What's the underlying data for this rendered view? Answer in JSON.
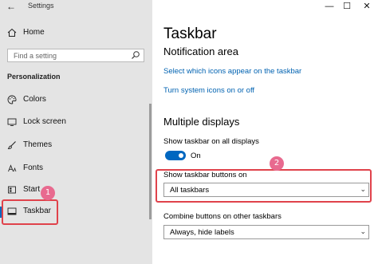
{
  "window": {
    "title": "Settings",
    "back_glyph": "←",
    "minimize_glyph": "—",
    "maximize_glyph": "☐",
    "close_glyph": "✕"
  },
  "sidebar": {
    "home_label": "Home",
    "search_placeholder": "Find a setting",
    "section_title": "Personalization",
    "items": [
      {
        "label": "Colors",
        "icon": "palette-icon"
      },
      {
        "label": "Lock screen",
        "icon": "lock-screen-icon"
      },
      {
        "label": "Themes",
        "icon": "brush-icon"
      },
      {
        "label": "Fonts",
        "icon": "font-icon"
      },
      {
        "label": "Start",
        "icon": "start-icon"
      },
      {
        "label": "Taskbar",
        "icon": "taskbar-icon"
      }
    ],
    "selected": "Taskbar"
  },
  "main": {
    "title": "Taskbar",
    "notification_heading": "Notification area",
    "link_select_icons": "Select which icons appear on the taskbar",
    "link_system_icons": "Turn system icons on or off",
    "multiple_heading": "Multiple displays",
    "show_all_label": "Show taskbar on all displays",
    "toggle_state": "On",
    "show_buttons_label": "Show taskbar buttons on",
    "show_buttons_value": "All taskbars",
    "combine_label": "Combine buttons on other taskbars",
    "combine_value": "Always, hide labels"
  },
  "annotations": {
    "badge_1": "1",
    "badge_2": "2",
    "highlight_color": "#e0424b",
    "badge_color": "#e86a8f"
  },
  "colors": {
    "accent": "#0067c0",
    "link": "#0062b1",
    "sidebar_bg": "#e4e4e4"
  }
}
